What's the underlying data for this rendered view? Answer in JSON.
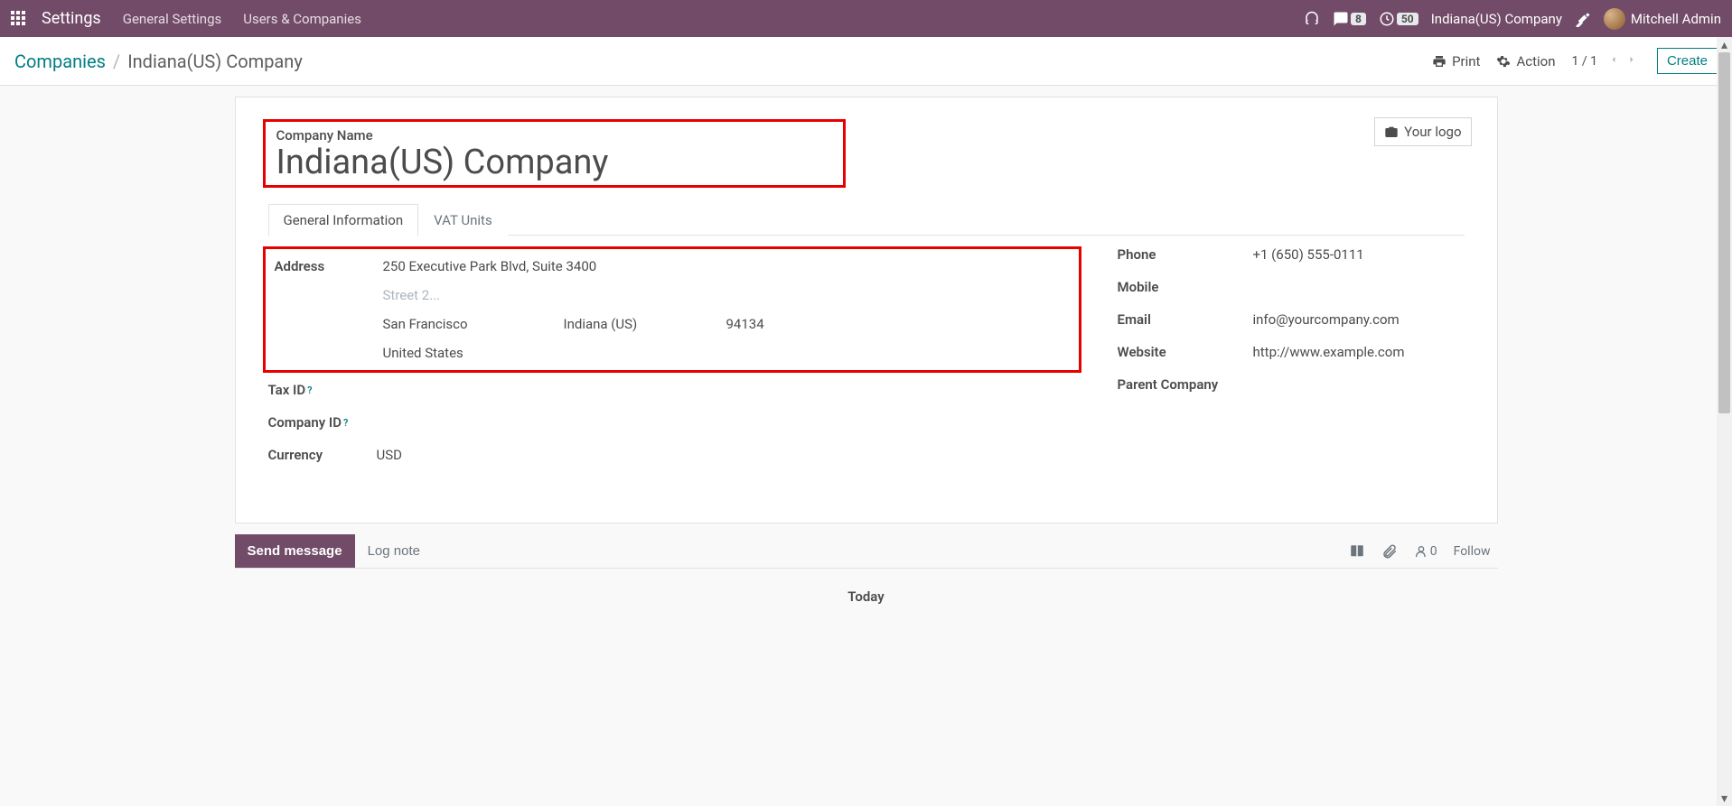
{
  "navbar": {
    "brand": "Settings",
    "links": [
      "General Settings",
      "Users & Companies"
    ],
    "messages_badge": "8",
    "activities_badge": "50",
    "company": "Indiana(US) Company",
    "user": "Mitchell Admin"
  },
  "control_panel": {
    "breadcrumb_root": "Companies",
    "breadcrumb_current": "Indiana(US) Company",
    "print": "Print",
    "action": "Action",
    "pager": "1 / 1",
    "create": "Create"
  },
  "form": {
    "title_label": "Company Name",
    "title_value": "Indiana(US) Company",
    "logo_button": "Your logo",
    "tabs": {
      "general": "General Information",
      "vat": "VAT Units"
    },
    "labels": {
      "address": "Address",
      "tax_id": "Tax ID",
      "company_id": "Company ID",
      "currency": "Currency",
      "phone": "Phone",
      "mobile": "Mobile",
      "email": "Email",
      "website": "Website",
      "parent_company": "Parent Company"
    },
    "address": {
      "street": "250 Executive Park Blvd, Suite 3400",
      "street2_placeholder": "Street 2...",
      "city": "San Francisco",
      "state": "Indiana (US)",
      "zip": "94134",
      "country": "United States"
    },
    "currency": "USD",
    "phone": "+1 (650) 555-0111",
    "email": "info@yourcompany.com",
    "website": "http://www.example.com"
  },
  "chatter": {
    "send_message": "Send message",
    "log_note": "Log note",
    "follower_count": "0",
    "follow": "Follow",
    "today": "Today"
  }
}
